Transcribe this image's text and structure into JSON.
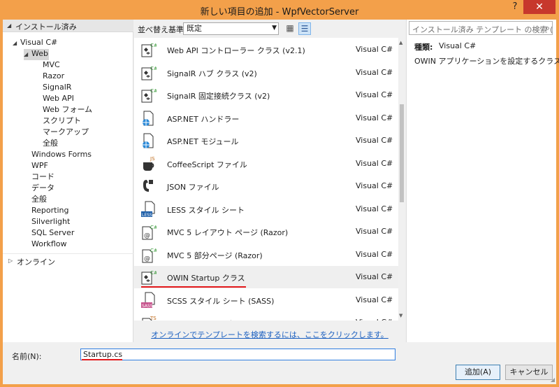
{
  "window": {
    "title": "新しい項目の追加 - WpfVectorServer",
    "help": "?",
    "close": "✕"
  },
  "tree": {
    "header": "インストール済み",
    "items": [
      {
        "label": "Visual C#",
        "indent": 1
      },
      {
        "label": "Web",
        "indent": 2
      },
      {
        "label": "MVC",
        "indent": 3
      },
      {
        "label": "Razor",
        "indent": 3
      },
      {
        "label": "SignalR",
        "indent": 3
      },
      {
        "label": "Web API",
        "indent": 3
      },
      {
        "label": "Web フォーム",
        "indent": 3
      },
      {
        "label": "スクリプト",
        "indent": 3
      },
      {
        "label": "マークアップ",
        "indent": 3
      },
      {
        "label": "全般",
        "indent": 3
      },
      {
        "label": "Windows Forms",
        "indent": 2
      },
      {
        "label": "WPF",
        "indent": 2
      },
      {
        "label": "コード",
        "indent": 2
      },
      {
        "label": "データ",
        "indent": 2
      },
      {
        "label": "全般",
        "indent": 2
      },
      {
        "label": "Reporting",
        "indent": 2
      },
      {
        "label": "Silverlight",
        "indent": 2
      },
      {
        "label": "SQL Server",
        "indent": 2
      },
      {
        "label": "Workflow",
        "indent": 2
      }
    ],
    "online": "オンライン"
  },
  "toolbar": {
    "sort_label": "並べ替え基準:",
    "sort_value": "既定"
  },
  "templates": [
    {
      "name": "Web API コントローラー クラス (v2.1)",
      "type": "Visual C#",
      "icon": "csharp-class-icon"
    },
    {
      "name": "SignalR ハブ クラス (v2)",
      "type": "Visual C#",
      "icon": "csharp-class-icon"
    },
    {
      "name": "SignalR 固定接続クラス (v2)",
      "type": "Visual C#",
      "icon": "csharp-class-icon"
    },
    {
      "name": "ASP.NET ハンドラー",
      "type": "Visual C#",
      "icon": "web-handler-icon"
    },
    {
      "name": "ASP.NET モジュール",
      "type": "Visual C#",
      "icon": "web-module-icon"
    },
    {
      "name": "CoffeeScript ファイル",
      "type": "Visual C#",
      "icon": "coffeescript-icon"
    },
    {
      "name": "JSON ファイル",
      "type": "Visual C#",
      "icon": "json-icon"
    },
    {
      "name": "LESS スタイル シート",
      "type": "Visual C#",
      "icon": "less-icon"
    },
    {
      "name": "MVC 5 レイアウト ページ (Razor)",
      "type": "Visual C#",
      "icon": "razor-page-icon"
    },
    {
      "name": "MVC 5 部分ページ (Razor)",
      "type": "Visual C#",
      "icon": "razor-page-icon"
    },
    {
      "name": "OWIN Startup クラス",
      "type": "Visual C#",
      "icon": "csharp-class-icon",
      "selected": true
    },
    {
      "name": "SCSS スタイル シート (SASS)",
      "type": "Visual C#",
      "icon": "scss-icon"
    },
    {
      "name": "TypeScript ファイル",
      "type": "Visual C#",
      "icon": "typescript-icon"
    }
  ],
  "online_link": "オンラインでテンプレートを検索するには、ここをクリックします。",
  "search": {
    "placeholder": "インストール済み テンプレート の検索 (Ctrl+E)"
  },
  "details": {
    "kind_label": "種類:",
    "kind_value": "Visual C#",
    "description": "OWIN アプリケーションを設定するクラス"
  },
  "name_field": {
    "label": "名前(N):",
    "value": "Startup.cs"
  },
  "buttons": {
    "ok": "追加(A)",
    "cancel": "キャンセル"
  },
  "colors": {
    "accent": "#f3a04a",
    "close": "#c7382c",
    "link": "#1a5fc0",
    "highlight": "#e3181b"
  }
}
